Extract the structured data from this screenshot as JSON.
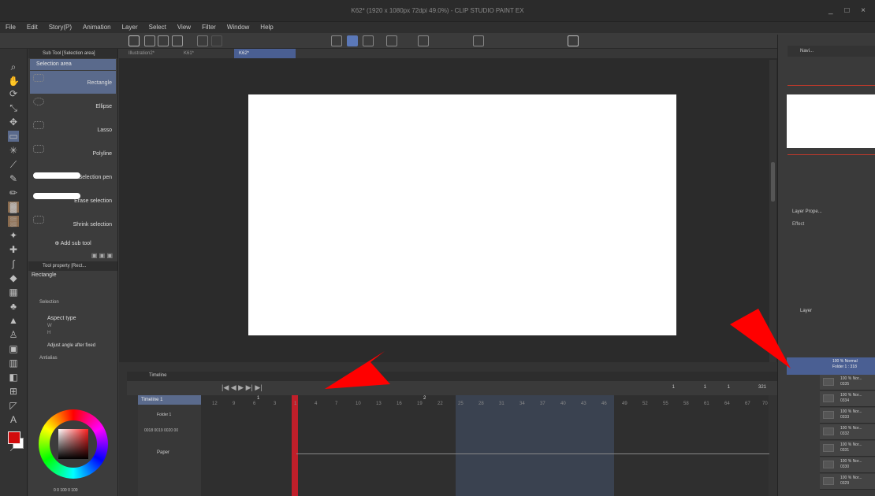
{
  "window": {
    "title": "K62* (1920 x 1080px 72dpi 49.0%) - CLIP STUDIO PAINT EX",
    "controls": "_ □ ×"
  },
  "menu": [
    "File",
    "Edit",
    "Story(P)",
    "Animation",
    "Layer",
    "Select",
    "View",
    "Filter",
    "Window",
    "Help"
  ],
  "tabs": [
    {
      "label": "Illustration2*"
    },
    {
      "label": "K61*"
    },
    {
      "label": "K62*"
    }
  ],
  "subtool": {
    "header": "Sub Tool [Selection area]",
    "set_label": "Selection area",
    "items": [
      "Rectangle",
      "Ellipse",
      "Lasso",
      "Polyline",
      "Selection pen",
      "Erase selection",
      "Shrink selection"
    ],
    "add_label": "Add sub tool"
  },
  "toolprop": {
    "header": "Tool property [Rect...",
    "name": "Rectangle",
    "selection_label": "Selection",
    "aspect_label": "Aspect type",
    "w_label": "W",
    "h_label": "H",
    "angle_label": "Adjust angle after fixed",
    "antialias_label": "Antialias"
  },
  "color": {
    "primary": "#d10d0d",
    "values": "0  0  100  0  100"
  },
  "timeline": {
    "panel_label": "Timeline",
    "name": "Timeline 1",
    "folder": "Folder 1",
    "cells": "0018 0019 0020 00",
    "paper": "Paper",
    "frames": [
      "12",
      "9",
      "6",
      "3",
      "1",
      "4",
      "7",
      "10",
      "13",
      "16",
      "19",
      "22",
      "25",
      "28",
      "31",
      "34",
      "37",
      "40",
      "43",
      "46",
      "49",
      "52",
      "55",
      "58",
      "61",
      "64",
      "67",
      "70"
    ],
    "markers": [
      "1",
      "2"
    ],
    "end_values": [
      "1",
      "1",
      "1",
      "321"
    ]
  },
  "right": {
    "navigator": "Navi...",
    "layer_property": "Layer Prope...",
    "effect": "Effect",
    "layer_tab": "Layer",
    "folder_layer": "100 % Normal\nFolder 1 : 318",
    "layers": [
      {
        "opacity": "100 % Nor...",
        "name": "0335"
      },
      {
        "opacity": "100 % Nor...",
        "name": "0334"
      },
      {
        "opacity": "100 % Nor...",
        "name": "0333"
      },
      {
        "opacity": "100 % Nor...",
        "name": "0332"
      },
      {
        "opacity": "100 % Nor...",
        "name": "0331"
      },
      {
        "opacity": "100 % Nor...",
        "name": "0330"
      },
      {
        "opacity": "100 % Nor...",
        "name": "0329"
      }
    ]
  }
}
